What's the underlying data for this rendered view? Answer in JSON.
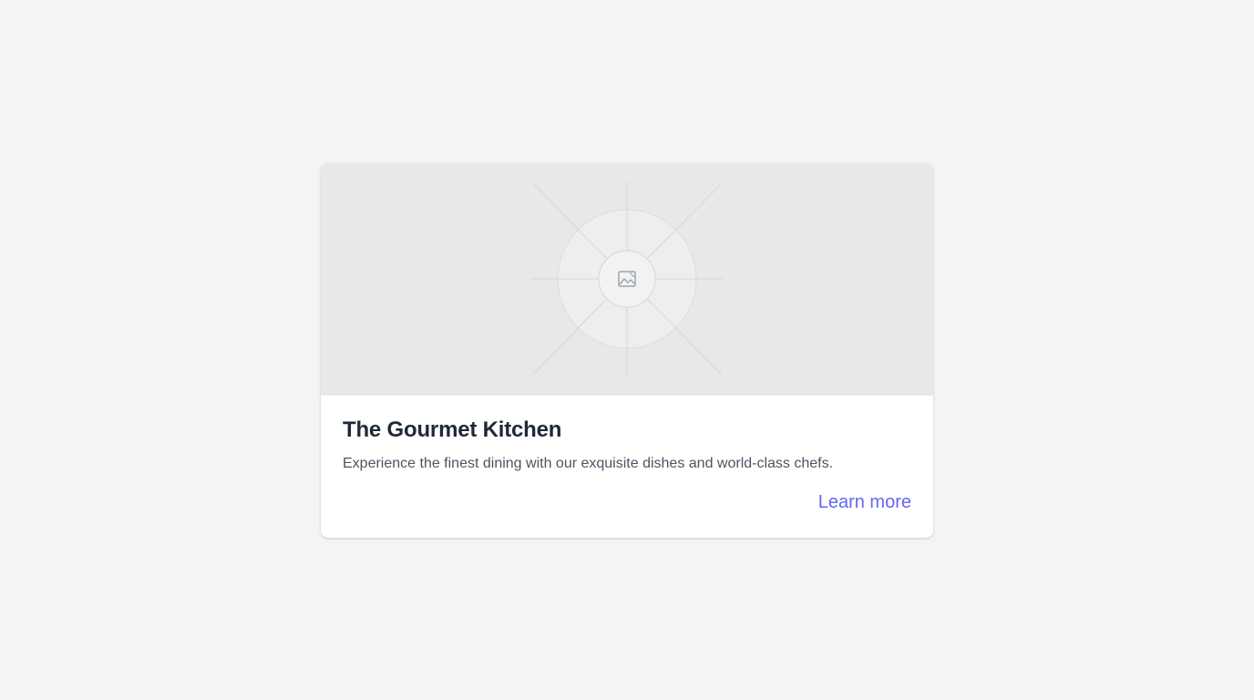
{
  "card": {
    "image": {
      "icon": "image-icon",
      "background": "#e8e8e8"
    },
    "title": "The Gourmet Kitchen",
    "description": "Experience the finest dining with our exquisite dishes and world-class chefs.",
    "link_label": "Learn more",
    "link_color": "#6366f1"
  }
}
